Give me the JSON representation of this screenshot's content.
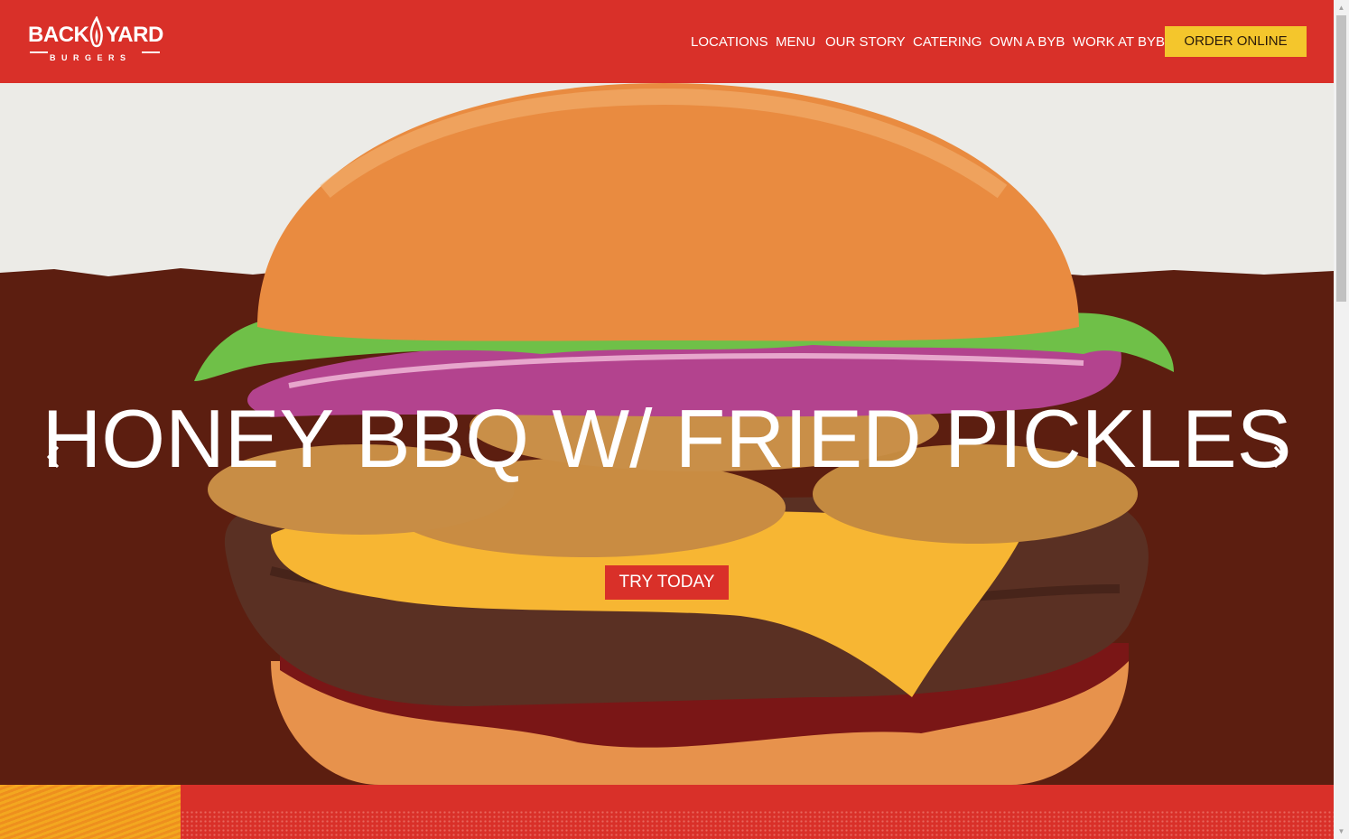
{
  "brand": {
    "logo_top": "BACK",
    "logo_top_right": "YARD",
    "logo_bottom": "BURGERS"
  },
  "nav": {
    "items": [
      {
        "label": "LOCATIONS"
      },
      {
        "label": "MENU"
      },
      {
        "label": "OUR STORY"
      },
      {
        "label": "CATERING"
      },
      {
        "label": "OWN A BYB"
      },
      {
        "label": "WORK AT BYB"
      }
    ],
    "cta_label": "ORDER ONLINE"
  },
  "hero": {
    "title": "HONEY BBQ W/ FRIED PICKLES",
    "button_label": "TRY TODAY",
    "prev_icon": "chevron-left-icon",
    "next_icon": "chevron-right-icon"
  },
  "colors": {
    "brand_red": "#d93029",
    "cta_yellow": "#f4c62c",
    "hero_brown": "#5c1e10"
  }
}
